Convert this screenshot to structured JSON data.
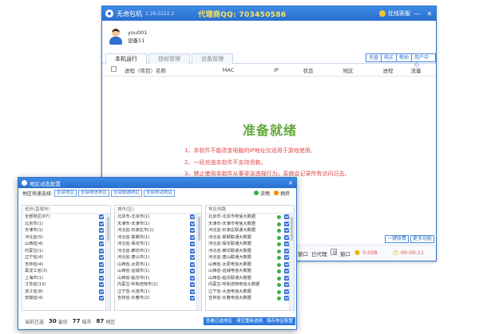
{
  "main_window": {
    "app_name": "无虑包机",
    "version": "1.26.0222.2",
    "qq_banner": "代理商QQ: 703450586",
    "service_label": "在线客服",
    "controls": [
      "—",
      "✕"
    ],
    "user": {
      "name": "you001",
      "device": "设备11"
    },
    "tabs": [
      "本机运行",
      "授权管理",
      "设备管理"
    ],
    "tool_buttons": [
      "充值",
      "购买",
      "帮助",
      "用户中心"
    ],
    "columns": [
      "进程（项目）名称",
      "MAC",
      "IP",
      "状态",
      "地区",
      "进程",
      "流量"
    ],
    "ready_text": "准备就绪",
    "notices": [
      "1、本软件不能改变电脑的IP地址仅适用于游戏使用。",
      "2、一经充值本软件不支持退款。",
      "3、禁止使用本软件从事非法违规行为，系统会记录所有访问日志。"
    ],
    "status": {
      "pre_label": "窗口",
      "used_label": "已代理",
      "used_value": "0",
      "window_label": "窗口",
      "balance": "0.008",
      "time": "00:00:11",
      "btn_record": "一键续费",
      "btn_more": "更多功能"
    }
  },
  "popup": {
    "title": "地区动态配置",
    "filter_label": "地区快速选择:",
    "filter_buttons": [
      "全部地区",
      "全部电信地区",
      "全部联通地区",
      "全部移动地区"
    ],
    "legend": [
      {
        "label": "流畅",
        "color": "#37b24d"
      },
      {
        "label": "拥挤",
        "color": "#f08c00"
      }
    ],
    "columns": {
      "province": {
        "header": "省份(直辖市)",
        "items": [
          "全部地区(87)",
          "北京市(1)",
          "天津市(1)",
          "河北省(5)",
          "山西省(4)",
          "内蒙古(1)",
          "辽宁省(4)",
          "吉林省(4)",
          "黑龙江省(3)",
          "上海市(1)",
          "江苏省(13)",
          "浙江省(8)",
          "安徽省(4)"
        ]
      },
      "city": {
        "header": "城市(区)",
        "items": [
          "北京市-北京市(1)",
          "天津市-天津市(1)",
          "河北省-石家庄市(1)",
          "河北省-邯郸市(1)",
          "河北省-保定市(1)",
          "河北省-廊坊市(1)",
          "河北省-唐山市(1)",
          "山西省-太原市(1)",
          "山西省-运城市(1)",
          "山西省-临汾市(1)",
          "内蒙古-呼和浩特市(1)",
          "辽宁省-大连市(1)",
          "吉林省-长春市(2)"
        ]
      },
      "line": {
        "header": "地区线路",
        "items": [
          "北京市-北京市电信大数据",
          "天津市-天津市电信大数据",
          "河北省-石家庄联通大数据",
          "河北省-邯郸联通大数据",
          "河北省-保定联通大数据",
          "河北省-廊坊联通大数据",
          "河北省-唐山联通大数据",
          "山西省-太原电信大数据",
          "山西省-运城电信大数据",
          "山西省-临汾联通大数据",
          "内蒙古-呼和浩特电信大数据",
          "辽宁省-大连电信大数据",
          "吉林省-长春电信大数据"
        ]
      }
    },
    "footer": {
      "prefix": "当前已选",
      "province_count": "30",
      "province_unit": "省份",
      "city_count": "77",
      "city_unit": "城市",
      "line_count": "87",
      "line_unit": "地区",
      "btn_view": "查看已选地区",
      "btn_clear": "清空重新选择",
      "btn_save": "保存地区配置"
    }
  }
}
